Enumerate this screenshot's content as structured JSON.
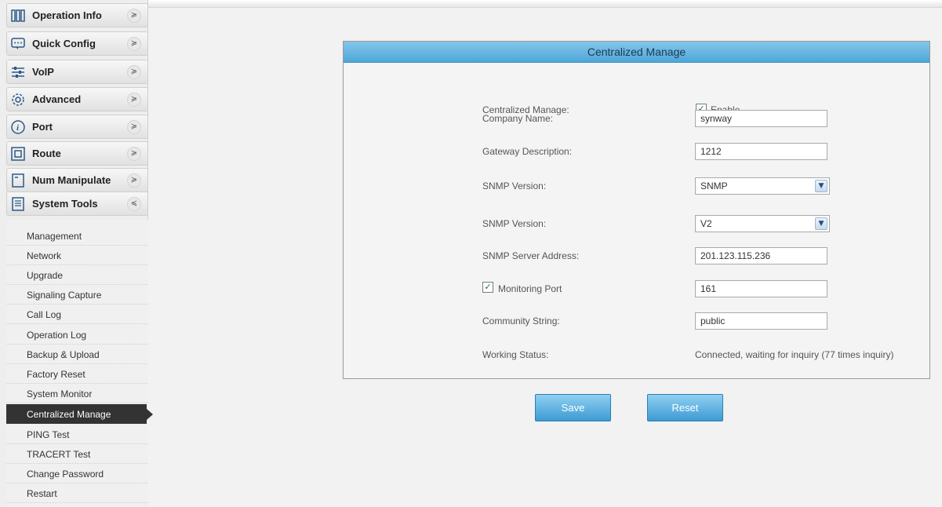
{
  "sidebar": {
    "nav": [
      {
        "label": "Operation Info",
        "icon": "operation-info-icon",
        "chevron": "≽"
      },
      {
        "label": "Quick Config",
        "icon": "quick-config-icon",
        "chevron": "≽"
      },
      {
        "label": "VoIP",
        "icon": "voip-icon",
        "chevron": "≽"
      },
      {
        "label": "Advanced",
        "icon": "advanced-gear-icon",
        "chevron": "≽"
      },
      {
        "label": "Port",
        "icon": "port-info-icon",
        "chevron": "≽"
      },
      {
        "label": "Route",
        "icon": "route-icon",
        "chevron": "≽"
      },
      {
        "label": "Num Manipulate",
        "icon": "num-manipulate-icon",
        "chevron": "≽"
      },
      {
        "label": "System Tools",
        "icon": "system-tools-icon",
        "chevron": "≼"
      }
    ],
    "submenu": [
      {
        "label": "Management"
      },
      {
        "label": "Network"
      },
      {
        "label": "Upgrade"
      },
      {
        "label": "Signaling Capture"
      },
      {
        "label": "Call Log"
      },
      {
        "label": "Operation Log"
      },
      {
        "label": "Backup & Upload"
      },
      {
        "label": "Factory Reset"
      },
      {
        "label": "System Monitor"
      },
      {
        "label": "Centralized Manage"
      },
      {
        "label": "PING Test"
      },
      {
        "label": "TRACERT Test"
      },
      {
        "label": "Change Password"
      },
      {
        "label": "Restart"
      }
    ],
    "active_submenu": "Centralized Manage"
  },
  "panel": {
    "title": "Centralized Manage",
    "centralized_label": "Centralized Manage:",
    "enable_label": "Enable",
    "enable_checked": true,
    "company_label": "Company Name:",
    "company_value": "synway",
    "gateway_label": "Gateway Description:",
    "gateway_value": "1212",
    "snmp_version_label_1": "SNMP Version:",
    "snmp_version_value_1": "SNMP",
    "snmp_version_label_2": "SNMP Version:",
    "snmp_version_value_2": "V2",
    "server_label": "SNMP Server Address:",
    "server_value": "201.123.115.236",
    "monitoring_label": "Monitoring Port",
    "monitoring_checked": true,
    "monitoring_value": "161",
    "community_label": "Community String:",
    "community_value": "public",
    "status_label": "Working Status:",
    "status_value": "Connected, waiting for inquiry (77 times inquiry)"
  },
  "buttons": {
    "save": "Save",
    "reset": "Reset"
  },
  "colors": {
    "header_blue": "#4ea6d8",
    "active_menu": "#333333",
    "button_blue": "#3d9bd3"
  }
}
